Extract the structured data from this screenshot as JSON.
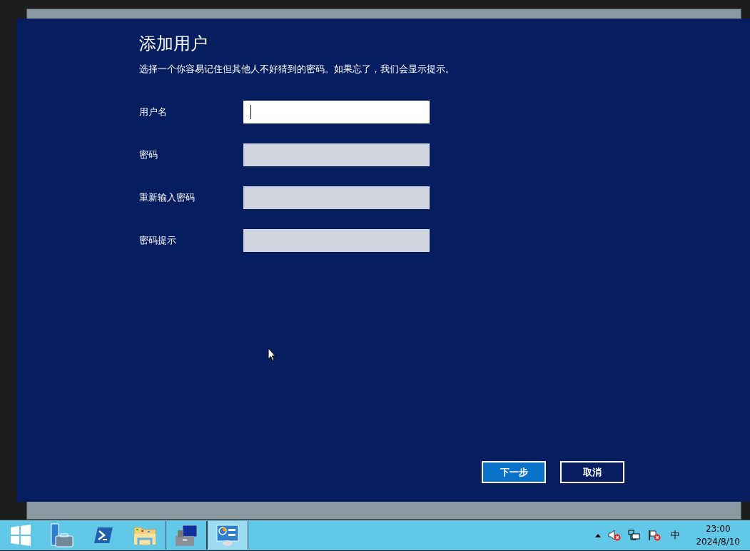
{
  "dialog": {
    "title": "添加用户",
    "subtitle": "选择一个你容易记住但其他人不好猜到的密码。如果忘了，我们会显示提示。",
    "fields": [
      {
        "label": "用户名",
        "disabled": false,
        "focused": true
      },
      {
        "label": "密码",
        "disabled": true,
        "focused": false
      },
      {
        "label": "重新输入密码",
        "disabled": true,
        "focused": false
      },
      {
        "label": "密码提示",
        "disabled": true,
        "focused": false
      }
    ],
    "buttons": [
      {
        "label": "下一步",
        "kind": "primary"
      },
      {
        "label": "取消",
        "kind": "secondary"
      }
    ]
  },
  "taskbar": {
    "items": [
      {
        "kind": "start",
        "selected": false
      },
      {
        "kind": "server",
        "selected": false
      },
      {
        "kind": "shell",
        "selected": false
      },
      {
        "kind": "folder",
        "selected": false
      },
      {
        "kind": "tools",
        "selected": false
      },
      {
        "kind": "panel",
        "selected": true
      }
    ],
    "ime": "中",
    "time": "23:00",
    "date": "2024/8/10"
  }
}
